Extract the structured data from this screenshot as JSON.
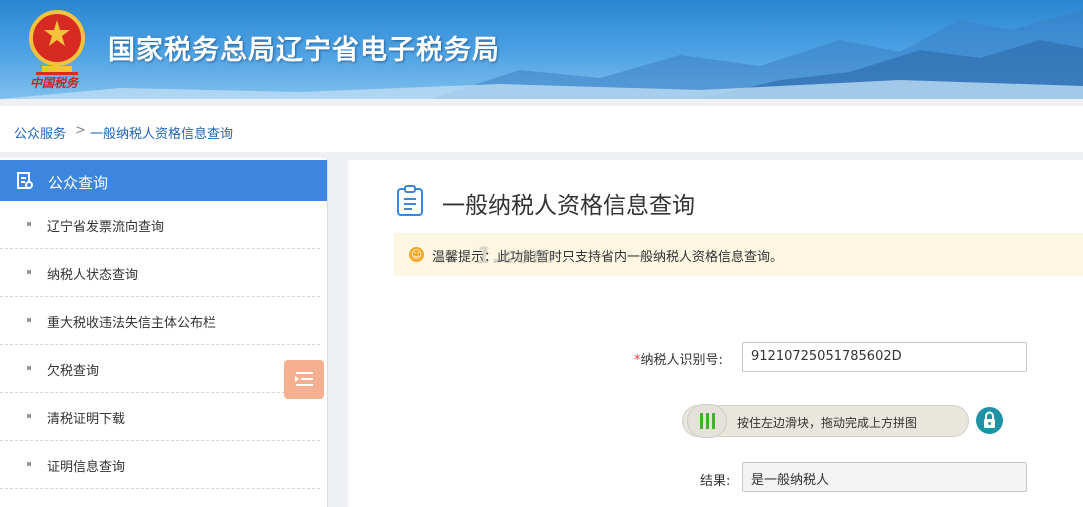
{
  "header": {
    "site_title": "国家税务总局辽宁省电子税务局",
    "emblem_caption": "中国税务"
  },
  "breadcrumb": {
    "home": "公众服务",
    "separator": ">",
    "current": "一般纳税人资格信息查询"
  },
  "sidebar": {
    "title": "公众查询",
    "items": [
      {
        "label": "辽宁省发票流向查询"
      },
      {
        "label": "纳税人状态查询"
      },
      {
        "label": "重大税收违法失信主体公布栏"
      },
      {
        "label": "欠税查询"
      },
      {
        "label": "清税证明下载"
      },
      {
        "label": "证明信息查询"
      }
    ]
  },
  "main": {
    "page_title": "一般纳税人资格信息查询",
    "notice": "温馨提示：此功能暂时只支持省内一般纳税人资格信息查询。",
    "watermark": "1.com",
    "taxpayer_id_label": "纳税人识别号:",
    "taxpayer_id_required": "*",
    "taxpayer_id_value": "91210725051785602D",
    "slider_text": "按住左边滑块，拖动完成上方拼图",
    "result_label": "结果:",
    "result_value": "是一般纳税人"
  },
  "colors": {
    "header_blue": "#2a86d0",
    "sidebar_active": "#3d86e0",
    "link_blue": "#1e63b5",
    "notice_bg": "#fcf6e2",
    "slider_handle_green": "#42b22c",
    "lock_teal": "#1f92a6",
    "toggle_orange": "#f4b08f"
  },
  "icons": {
    "sidebar_title_icon": "document-search-icon",
    "page_title_icon": "clipboard-list-icon",
    "notice_icon": "smile-warning-icon",
    "sidebar_toggle_icon": "menu-indent-icon",
    "slider_handle_icon": "grip-bars-icon",
    "lock_icon": "lock-icon"
  }
}
